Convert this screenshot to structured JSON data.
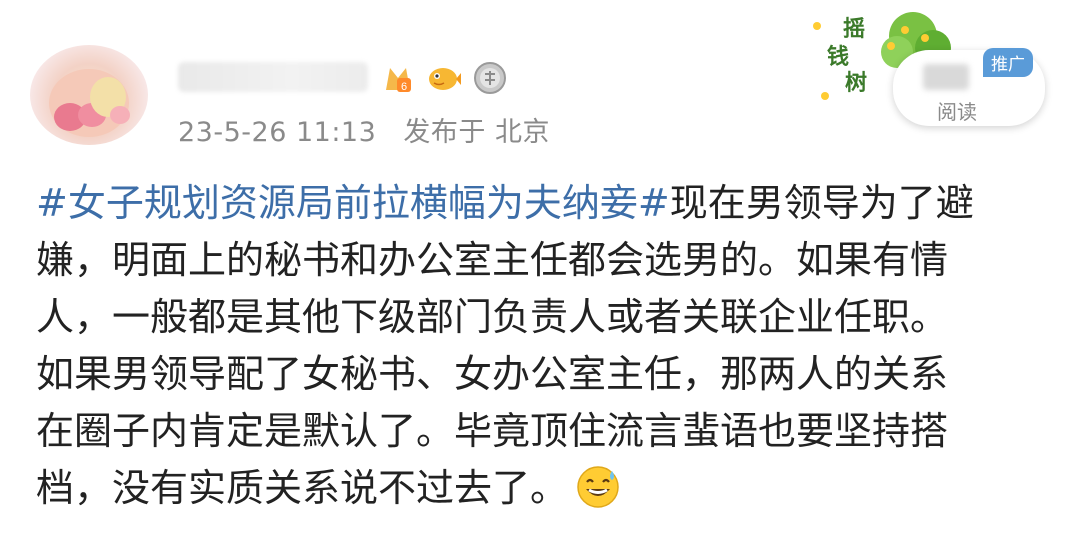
{
  "post": {
    "timestamp": "23-5-26 11:13",
    "source": "发布于 北京",
    "lines": [
      {
        "hashtag": "#女子规划资源局前拉横幅为夫纳妾#",
        "text": "现在男领导为了避"
      },
      {
        "text": "嫌，明面上的秘书和办公室主任都会选男的。如果有情"
      },
      {
        "text": "人，一般都是其他下级部门负责人或者关联企业任职。"
      },
      {
        "text": "如果男领导配了女秘书、女办公室主任，那两人的关系"
      },
      {
        "text": "在圈子内肯定是默认了。毕竟顶住流言蜚语也要坚持搭"
      },
      {
        "text": "档，没有实质关系说不过去了。"
      }
    ],
    "emoji": "sweat-smile-emoji"
  },
  "badges": [
    "vip-level-6-icon",
    "pufferfish-icon",
    "silver-medal-icon"
  ],
  "ad": {
    "image_text": [
      "摇",
      "钱",
      "树"
    ],
    "tag": "推广",
    "action": "阅读"
  },
  "colors": {
    "hashtag": "#3d6ea8",
    "meta": "#8a8a8a",
    "text": "#222222",
    "ad_tag": "#5a9bd8"
  }
}
